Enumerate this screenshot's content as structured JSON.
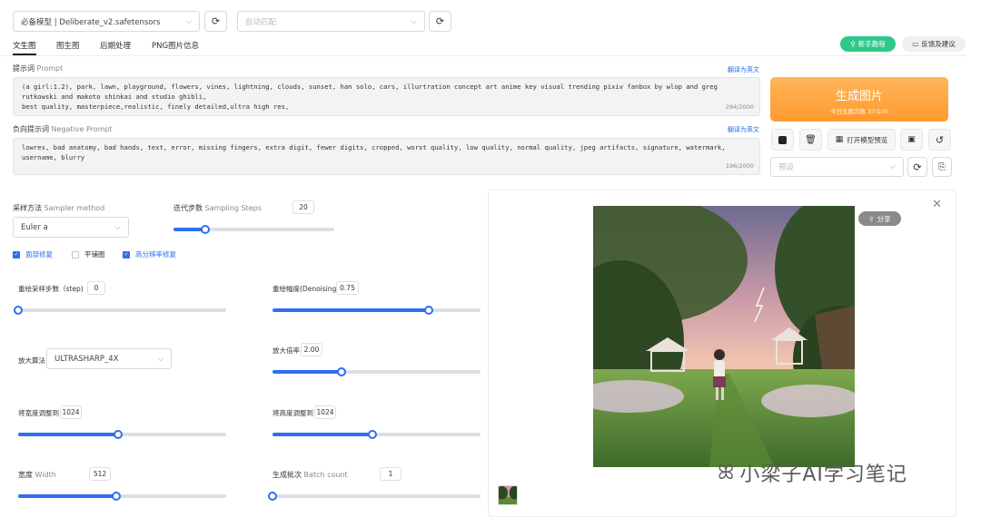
{
  "header": {
    "model_select": "必备模型 | Deliberate_v2.safetensors",
    "vae_placeholder": "自动匹配"
  },
  "tabs": [
    "文生图",
    "图生图",
    "后期处理",
    "PNG图片信息"
  ],
  "top_right": {
    "tutorial": "新手教程",
    "feedback": "反馈及建议"
  },
  "prompt": {
    "label_cn": "提示词",
    "label_en": "Prompt",
    "translate": "翻译为英文",
    "text": "(a girl:1.2), park, lawn, playground, flowers, vines, lightning, clouds, sunset, han solo, cars, illurtration concept art anime key visual trending pixiv fanbox by wlop and greg rutkowski and makoto shinkai and studio ghibli,\nbest quality, masterpiece,realistic, finely detailed,ultra high res,",
    "count": "294/2000"
  },
  "negative_prompt": {
    "label_cn": "负向提示词",
    "label_en": "Negative Prompt",
    "translate": "翻译为英文",
    "text": "lowres, bad anatomy, bad hands, text, error, missing fingers, extra digit, fewer digits, cropped, worst quality, low quality, normal quality, jpeg artifacts, signature, watermark, username, blurry",
    "count": "196/2000"
  },
  "generate": {
    "title": "生成图片",
    "subtitle": "今日生图次数 37/100"
  },
  "tools": {
    "open_preview": "打开模型预览",
    "preset_placeholder": "预设"
  },
  "sampler": {
    "label_cn": "采样方法",
    "label_en": "Sampler method",
    "value": "Euler a"
  },
  "steps": {
    "label_cn": "迭代步数",
    "label_en": "Sampling Steps",
    "value": "20",
    "level": 0.2
  },
  "options": [
    {
      "label": "面部修复",
      "checked": true
    },
    {
      "label": "平铺图",
      "checked": false
    },
    {
      "label": "高分辨率修复",
      "checked": true
    }
  ],
  "hires": {
    "redraw_steps": {
      "label": "重绘采样步数（step)",
      "value": "0",
      "level": 0
    },
    "denoising": {
      "label": "重绘幅度(Denoising)",
      "value": "0.75",
      "level": 0.75
    },
    "upscaler": {
      "label": "放大算法",
      "value": "ULTRASHARP_4X"
    },
    "scale": {
      "label": "放大倍率",
      "value": "2.00",
      "level": 0.33
    },
    "width_to": {
      "label": "将宽度调整到",
      "value": "1024",
      "level": 0.48
    },
    "height_to": {
      "label": "将高度调整到",
      "value": "1024",
      "level": 0.48
    }
  },
  "width": {
    "label_cn": "宽度",
    "label_en": "Width",
    "value": "512",
    "level": 0.47
  },
  "batch_count": {
    "label_cn": "生成批次",
    "label_en": "Batch count",
    "value": "1",
    "level": 0
  },
  "preview": {
    "share": "分享"
  },
  "watermark": "小梁子AI学习笔记",
  "colors": {
    "accent": "#2f6ef0",
    "generate": "#ff9f35",
    "tutorial": "#2ec98a"
  }
}
